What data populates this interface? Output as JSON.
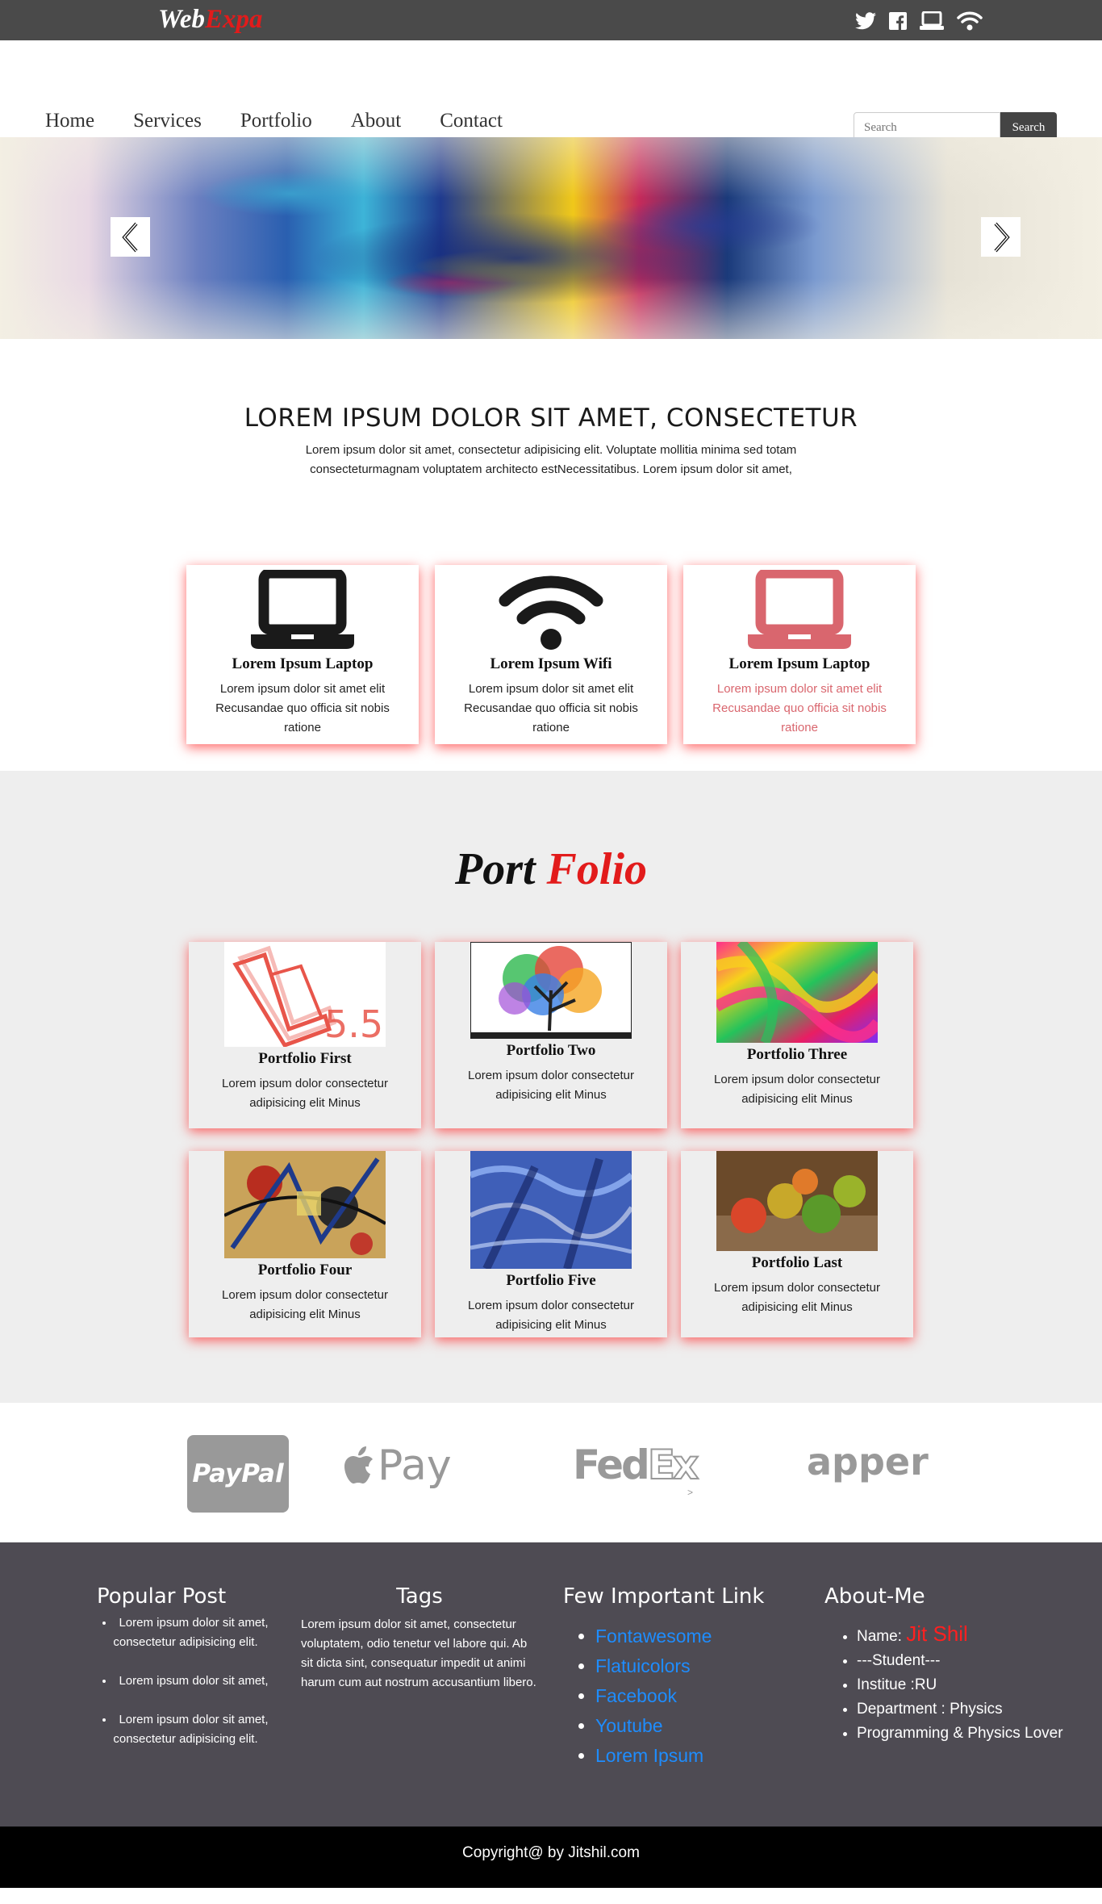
{
  "brand": {
    "part1": "Web",
    "part2": "Expa"
  },
  "social_icons": [
    "twitter-icon",
    "facebook-icon",
    "laptop-icon",
    "wifi-icon"
  ],
  "nav": {
    "items": [
      "Home",
      "Services",
      "Portfolio",
      "About",
      "Contact"
    ],
    "search_placeholder": "Search",
    "search_button": "Search"
  },
  "intro": {
    "heading": "LOREM IPSUM DOLOR SIT AMET, CONSECTETUR",
    "text": "Lorem ipsum dolor sit amet, consectetur adipisicing elit. Voluptate mollitia minima sed totam consecteturmagnam voluptatem architecto estNecessitatibus. Lorem ipsum dolor sit amet,"
  },
  "features": [
    {
      "title": "Lorem Ipsum Laptop",
      "text": "Lorem ipsum dolor sit amet elit Recusandae quo officia sit nobis ratione",
      "icon": "laptop-icon"
    },
    {
      "title": "Lorem Ipsum Wifi",
      "text": "Lorem ipsum dolor sit amet elit Recusandae quo officia sit nobis ratione",
      "icon": "wifi-icon"
    },
    {
      "title": "Lorem Ipsum Laptop",
      "text": "Lorem ipsum dolor sit amet elit Recusandae quo officia sit nobis ratione",
      "icon": "laptop-icon"
    }
  ],
  "portfolio": {
    "title_part1": "Port",
    "title_part2": "Folio",
    "items": [
      {
        "title": "Portfolio First",
        "text": "Lorem ipsum dolor consectetur adipisicing elit Minus",
        "badge": "5.5"
      },
      {
        "title": "Portfolio Two",
        "text": "Lorem ipsum dolor consectetur adipisicing elit Minus"
      },
      {
        "title": "Portfolio Three",
        "text": "Lorem ipsum dolor consectetur adipisicing elit Minus"
      },
      {
        "title": "Portfolio Four",
        "text": "Lorem ipsum dolor consectetur adipisicing elit Minus"
      },
      {
        "title": "Portfolio Five",
        "text": "Lorem ipsum dolor consectetur adipisicing elit Minus"
      },
      {
        "title": "Portfolio Last",
        "text": "Lorem ipsum dolor consectetur adipisicing elit Minus"
      }
    ]
  },
  "payments": {
    "paypal": "PayPal",
    "applepay": "Pay",
    "fedex_fed": "Fed",
    "fedex_ex": "Ex",
    "fedex_mark": ">",
    "apper": "apper"
  },
  "footer": {
    "popular_title": "Popular Post",
    "popular_posts": [
      "Lorem ipsum dolor sit amet, consectetur adipisicing elit.",
      "Lorem ipsum dolor sit amet,",
      "Lorem ipsum dolor sit amet, consectetur adipisicing elit."
    ],
    "tags_title": "Tags",
    "tags_text": "Lorem ipsum dolor sit amet, consectetur voluptatem, odio tenetur vel labore qui. Ab sit dicta sint, consequatur impedit ut animi harum cum aut nostrum accusantium libero.",
    "links_title": "Few Important Link",
    "links": [
      "Fontawesome",
      "Flatuicolors",
      "Facebook",
      "Youtube",
      "Lorem Ipsum"
    ],
    "about_title": "About-Me",
    "about_name_label": "Name:",
    "about_name": "Jit Shil",
    "about_items": [
      "---Student---",
      "Institue :RU",
      "Department : Physics",
      "Programming & Physics Lover"
    ]
  },
  "copyright": "Copyright@ by Jitshil.com",
  "colors": {
    "accent_red": "#e21b1b",
    "link_blue": "#1e8dff",
    "footer_bg": "#4e4b53",
    "topbar_bg": "#4a4a4a"
  }
}
